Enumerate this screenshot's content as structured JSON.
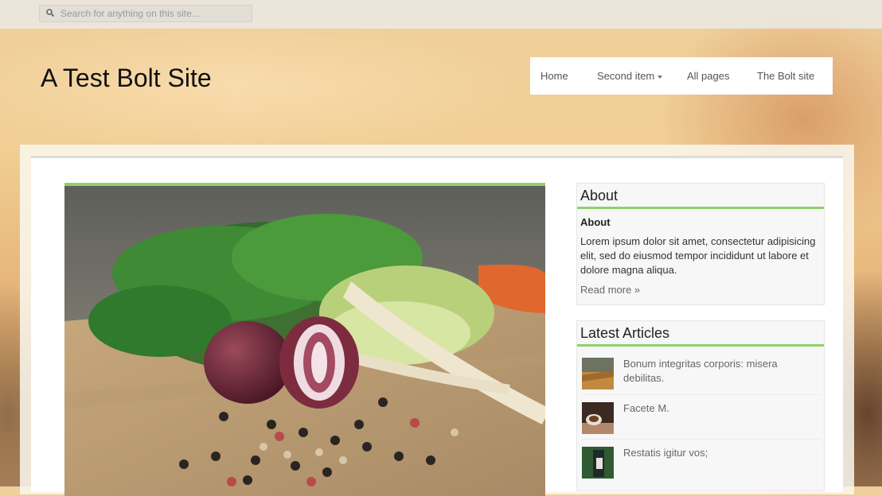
{
  "search": {
    "placeholder": "Search for anything on this site..."
  },
  "site": {
    "title": "A Test Bolt Site"
  },
  "nav": {
    "items": [
      {
        "label": "Home"
      },
      {
        "label": "Second item"
      },
      {
        "label": "All pages"
      },
      {
        "label": "The Bolt site"
      }
    ]
  },
  "about": {
    "heading": "About",
    "subheading": "About",
    "text": "Lorem ipsum dolor sit amet, consectetur adipisicing elit, sed do eiusmod tempor incididunt ut labore et dolore magna aliqua.",
    "read_more": "Read more »"
  },
  "latest": {
    "heading": "Latest Articles",
    "articles": [
      {
        "title": "Bonum integritas corporis: misera debilitas."
      },
      {
        "title": "Facete M."
      },
      {
        "title": "Restatis igitur vos;"
      }
    ]
  },
  "colors": {
    "accent": "#8fd16a",
    "nav_bg": "#ffffff",
    "topbar_bg": "#ebe8e1"
  }
}
